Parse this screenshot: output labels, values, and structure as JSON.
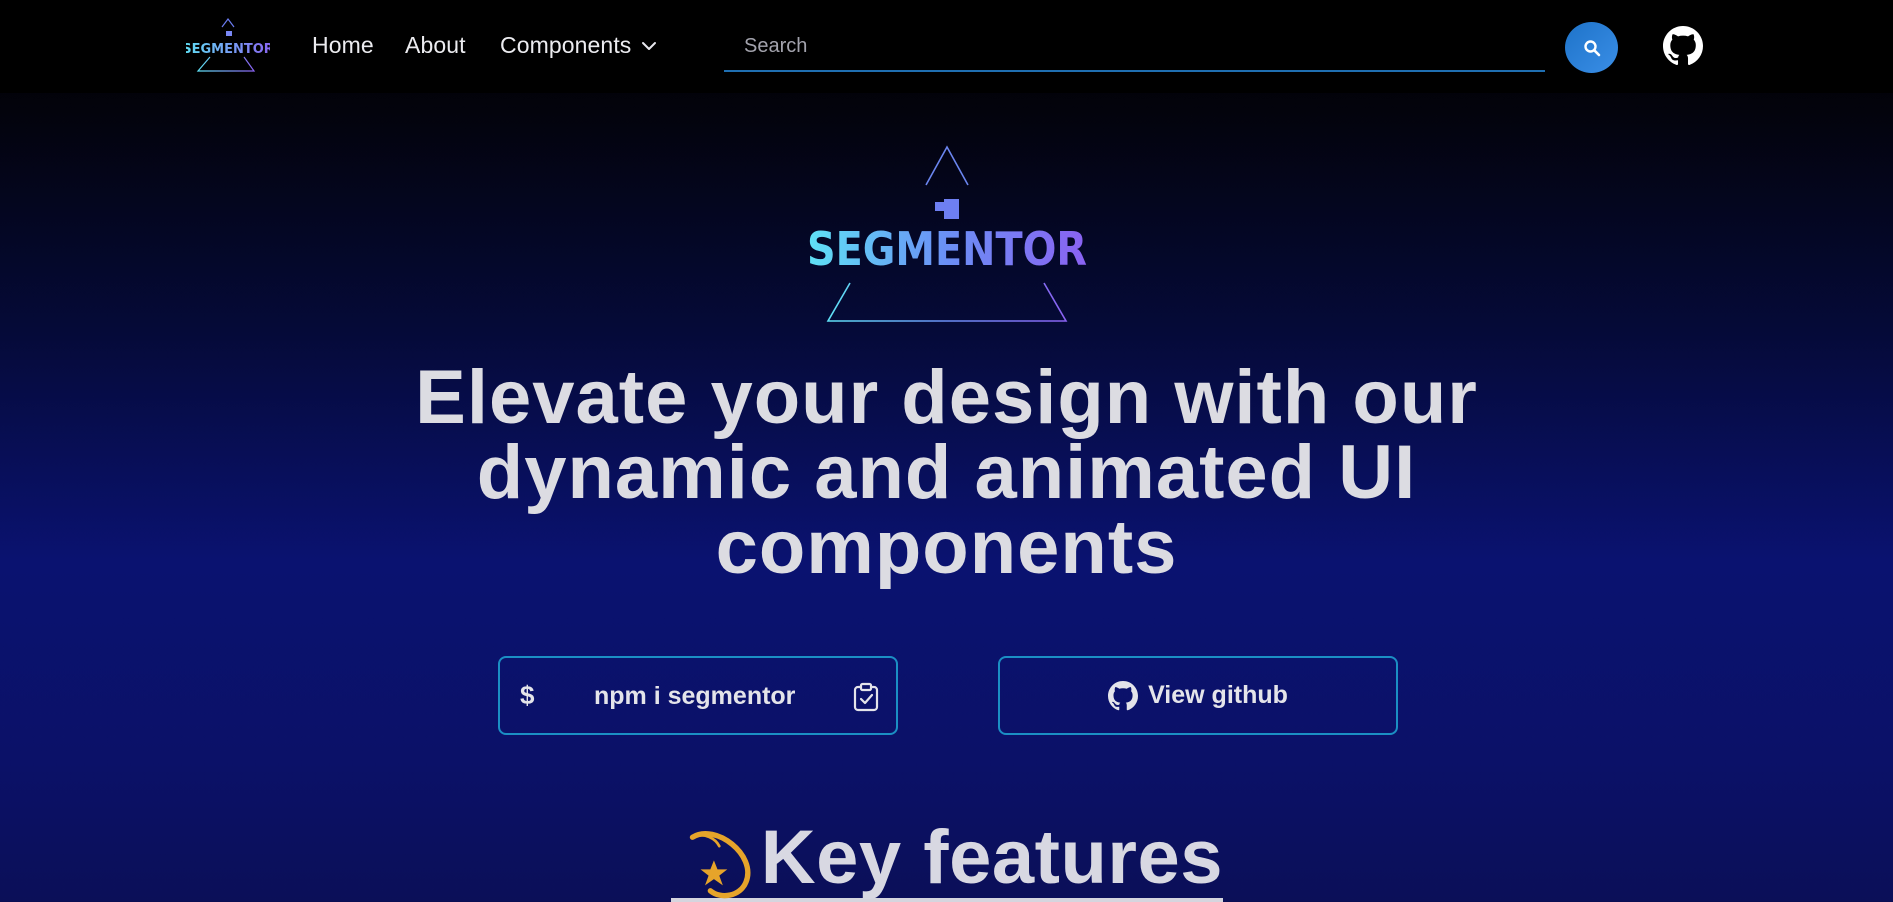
{
  "nav": {
    "logo_text": "SEGMENTOR",
    "links": {
      "home": "Home",
      "about": "About",
      "components": "Components"
    },
    "search": {
      "placeholder": "Search",
      "value": ""
    },
    "search_icon": "search-icon",
    "github_icon": "github-icon"
  },
  "hero": {
    "logo_text": "SEGMENTOR",
    "headline": "Elevate your design with our dynamic and animated UI components",
    "install": {
      "prefix": "$",
      "command": "npm i segmentor",
      "icon": "clipboard-check-icon"
    },
    "github_button": {
      "label": "View github",
      "icon": "github-icon"
    }
  },
  "features": {
    "heading": "Key features",
    "icon": "shooting-star-icon"
  },
  "colors": {
    "accent_blue": "#1e73c9",
    "border_cyan": "#1b8fc4",
    "logo_cyan": "#5fe1f5",
    "logo_purple": "#8a62f2",
    "star_gold": "#e6a42a",
    "bg_navy": "#0a1270"
  }
}
